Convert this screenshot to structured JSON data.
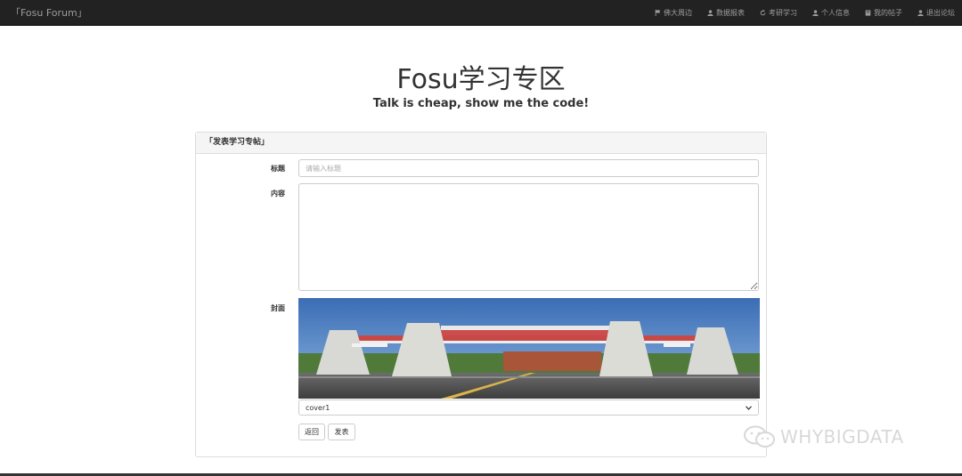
{
  "navbar": {
    "brand": "「Fosu Forum」",
    "items": [
      {
        "label": "佛大周边",
        "icon": "flag-icon"
      },
      {
        "label": "数据报表",
        "icon": "user-icon"
      },
      {
        "label": "考研学习",
        "icon": "refresh-icon"
      },
      {
        "label": "个人信息",
        "icon": "user-icon"
      },
      {
        "label": "我的帖子",
        "icon": "book-icon"
      },
      {
        "label": "退出论坛",
        "icon": "user-icon"
      }
    ]
  },
  "header": {
    "title": "Fosu学习专区",
    "subtitle": "Talk is cheap, show me the code!"
  },
  "panel": {
    "heading": "「发表学习专帖」",
    "title_label": "标题",
    "title_placeholder": "请输入标题",
    "content_label": "内容",
    "cover_label": "封面",
    "cover_select": "cover1",
    "back_button": "返回",
    "publish_button": "发表"
  },
  "watermark": "WHYBIGDATA"
}
